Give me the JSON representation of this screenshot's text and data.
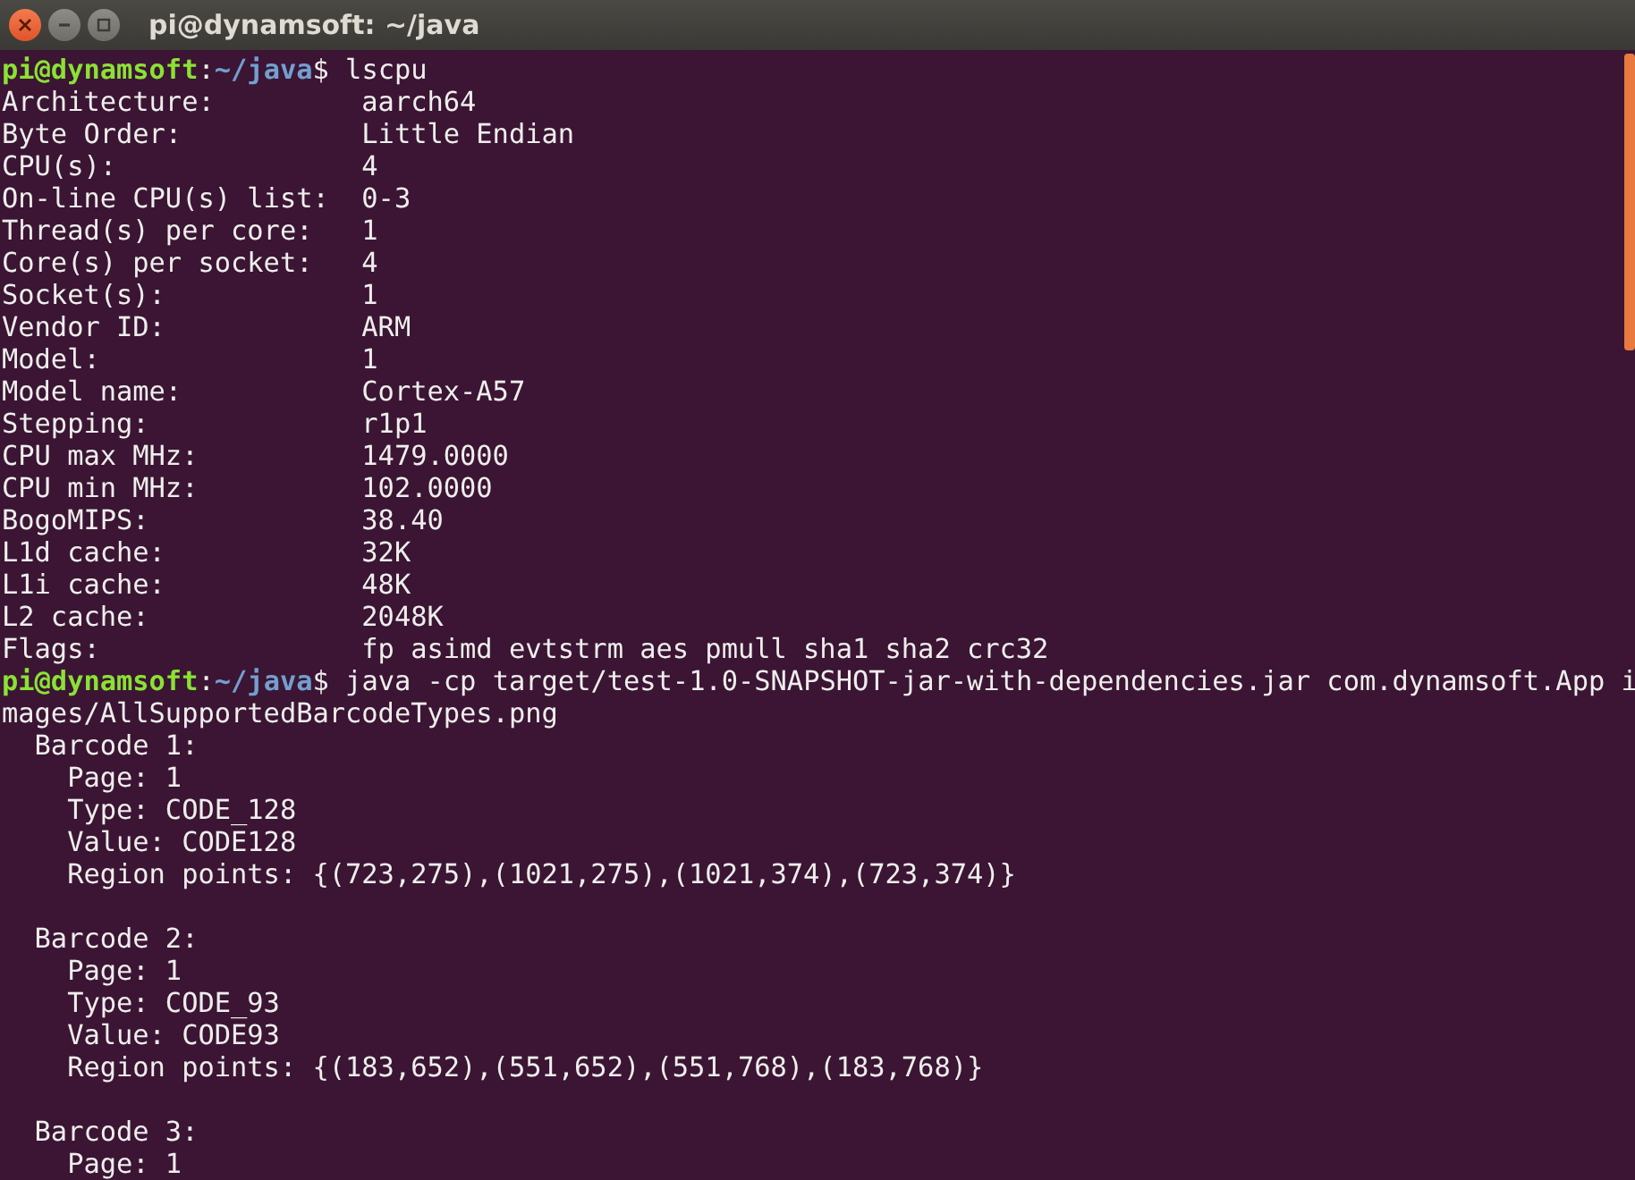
{
  "window": {
    "title": "pi@dynamsoft: ~/java"
  },
  "terminal": {
    "lines": [
      {
        "kind": "prompt",
        "user_host": "pi@dynamsoft",
        "separator": ":",
        "path": "~/java",
        "command": "$ lscpu"
      },
      {
        "kind": "output",
        "text": "Architecture:         aarch64"
      },
      {
        "kind": "output",
        "text": "Byte Order:           Little Endian"
      },
      {
        "kind": "output",
        "text": "CPU(s):               4"
      },
      {
        "kind": "output",
        "text": "On-line CPU(s) list:  0-3"
      },
      {
        "kind": "output",
        "text": "Thread(s) per core:   1"
      },
      {
        "kind": "output",
        "text": "Core(s) per socket:   4"
      },
      {
        "kind": "output",
        "text": "Socket(s):            1"
      },
      {
        "kind": "output",
        "text": "Vendor ID:            ARM"
      },
      {
        "kind": "output",
        "text": "Model:                1"
      },
      {
        "kind": "output",
        "text": "Model name:           Cortex-A57"
      },
      {
        "kind": "output",
        "text": "Stepping:             r1p1"
      },
      {
        "kind": "output",
        "text": "CPU max MHz:          1479.0000"
      },
      {
        "kind": "output",
        "text": "CPU min MHz:          102.0000"
      },
      {
        "kind": "output",
        "text": "BogoMIPS:             38.40"
      },
      {
        "kind": "output",
        "text": "L1d cache:            32K"
      },
      {
        "kind": "output",
        "text": "L1i cache:            48K"
      },
      {
        "kind": "output",
        "text": "L2 cache:             2048K"
      },
      {
        "kind": "output",
        "text": "Flags:                fp asimd evtstrm aes pmull sha1 sha2 crc32"
      },
      {
        "kind": "prompt",
        "user_host": "pi@dynamsoft",
        "separator": ":",
        "path": "~/java",
        "command": "$ java -cp target/test-1.0-SNAPSHOT-jar-with-dependencies.jar com.dynamsoft.App i"
      },
      {
        "kind": "output",
        "text": "mages/AllSupportedBarcodeTypes.png"
      },
      {
        "kind": "output",
        "text": "  Barcode 1:"
      },
      {
        "kind": "output",
        "text": "    Page: 1"
      },
      {
        "kind": "output",
        "text": "    Type: CODE_128"
      },
      {
        "kind": "output",
        "text": "    Value: CODE128"
      },
      {
        "kind": "output",
        "text": "    Region points: {(723,275),(1021,275),(1021,374),(723,374)}"
      },
      {
        "kind": "blank"
      },
      {
        "kind": "output",
        "text": "  Barcode 2:"
      },
      {
        "kind": "output",
        "text": "    Page: 1"
      },
      {
        "kind": "output",
        "text": "    Type: CODE_93"
      },
      {
        "kind": "output",
        "text": "    Value: CODE93"
      },
      {
        "kind": "output",
        "text": "    Region points: {(183,652),(551,652),(551,768),(183,768)}"
      },
      {
        "kind": "blank"
      },
      {
        "kind": "output",
        "text": "  Barcode 3:"
      },
      {
        "kind": "output",
        "text": "    Page: 1"
      }
    ]
  }
}
